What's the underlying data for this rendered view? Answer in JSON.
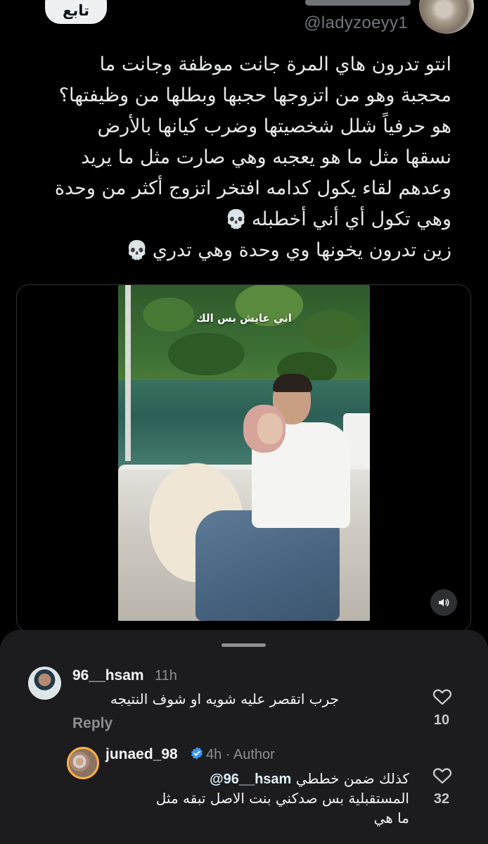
{
  "header": {
    "follow_label": "تابع",
    "handle": "@ladyzoeyy1"
  },
  "tweet": {
    "lines": [
      "انتو تدرون هاي المرة جانت موظفة وجانت ما",
      "محجبة وهو من اتزوجها حجبها وبطلها من وظيفتها؟",
      "هو حرفياً شلل شخصيتها وضرب كيانها بالأرض",
      "نسقها مثل ما هو يعجبه وهي صارت مثل ما يريد",
      "وعدهم لقاء يكول كدامه افتخر اتزوج أكثر من وحدة",
      "وهي تكول أي أني أخطبله",
      "زين تدرون يخونها وي وحدة وهي تدري"
    ],
    "skull_emoji": "💀"
  },
  "media": {
    "video_caption": "اني عايش بس الك",
    "sound_icon": "speaker-icon"
  },
  "comments": [
    {
      "username": "96__hsam",
      "time": "11h",
      "text": "جرب اتقصر عليه شويه او شوف النتيجه",
      "reply_label": "Reply",
      "likes": "10"
    },
    {
      "username": "junaed_98",
      "meta": "4h · Author",
      "mention": "@96__hsam",
      "text_line1": "كذلك ضمن خططي",
      "text_line2": "المستقبلية بس صدكني بنت الاصل تبقه مثل",
      "text_line3": "ما هي",
      "likes": "32"
    }
  ],
  "colors": {
    "background": "#000000",
    "sheet": "#1c1c1e",
    "muted": "#8e8e93",
    "verified": "#3897f0",
    "story_ring": "#fcb045"
  }
}
